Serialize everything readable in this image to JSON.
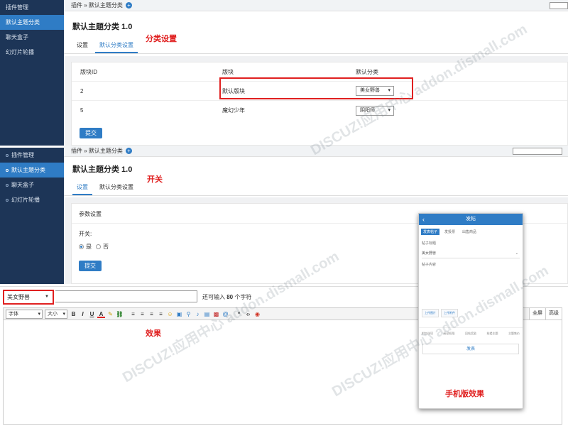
{
  "sidebar": {
    "items": [
      {
        "label": "插件管理"
      },
      {
        "label": "默认主题分类"
      },
      {
        "label": "聊天盒子"
      },
      {
        "label": "幻灯片轮播"
      }
    ]
  },
  "breadcrumb": {
    "text": "插件 » 默认主题分类",
    "plus": "+"
  },
  "plugin": {
    "title": "默认主题分类 1.0"
  },
  "tabs": [
    {
      "label": "设置"
    },
    {
      "label": "默认分类设置"
    }
  ],
  "notes": {
    "category_settings": "分类设置",
    "switch": "开关",
    "effect": "效果",
    "mobile_effect": "手机版效果"
  },
  "table": {
    "headers": [
      "版块ID",
      "版块",
      "默认分类"
    ],
    "rows": [
      {
        "id": "2",
        "forum": "默认版块",
        "category": "美女野兽"
      },
      {
        "id": "5",
        "forum": "魔幻少年",
        "category": "阴阳师"
      }
    ]
  },
  "submit_label": "提交",
  "params": {
    "section_title": "参数设置",
    "switch_label": "开关:",
    "yes": "是",
    "no": "否",
    "selected": "yes"
  },
  "phone": {
    "title": "发帖",
    "tabs": [
      "发表帖子",
      "发投票",
      "出售商品"
    ],
    "post_title_label": "帖子标题",
    "category_value": "美女野兽",
    "content_label": "帖子内容",
    "upload_image": "上传图片",
    "upload_attachment": "上传附件",
    "options": [
      "附加选项",
      "阅读权限",
      "回帖奖励",
      "抢楼主题",
      "主题售价"
    ],
    "submit": "发表"
  },
  "editor": {
    "category_value": "美女野兽",
    "hint_prefix": "还可输入",
    "hint_count": "80",
    "hint_suffix": "个字符",
    "font_label": "字体",
    "size_label": "大小",
    "fullscreen": "全屏",
    "advanced": "高级"
  },
  "watermark": {
    "text": "DISCUZ!应用中心 addon.dismall.com"
  }
}
